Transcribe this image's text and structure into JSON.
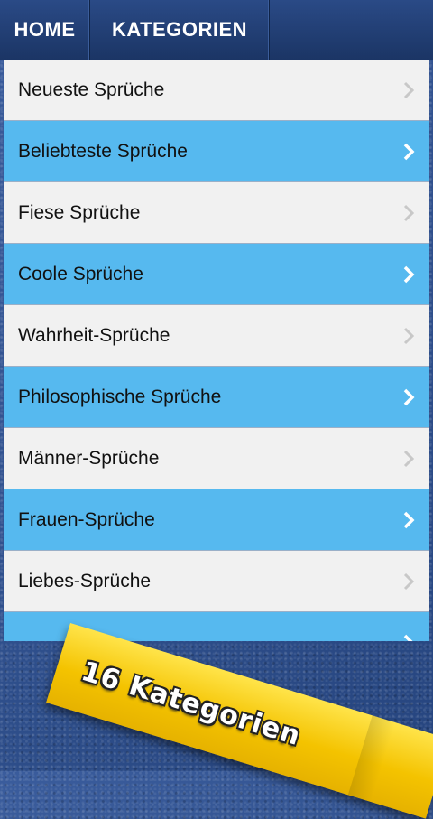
{
  "nav": {
    "home": "HOME",
    "categories": "KATEGORIEN"
  },
  "list": {
    "items": [
      {
        "label": "Neueste Sprüche",
        "style": "light"
      },
      {
        "label": "Beliebteste Sprüche",
        "style": "blue"
      },
      {
        "label": "Fiese Sprüche",
        "style": "light"
      },
      {
        "label": "Coole Sprüche",
        "style": "blue"
      },
      {
        "label": "Wahrheit-Sprüche",
        "style": "light"
      },
      {
        "label": "Philosophische Sprüche",
        "style": "blue"
      },
      {
        "label": "Männer-Sprüche",
        "style": "light"
      },
      {
        "label": "Frauen-Sprüche",
        "style": "blue"
      },
      {
        "label": "Liebes-Sprüche",
        "style": "light"
      },
      {
        "label": "",
        "style": "blue"
      }
    ]
  },
  "banner": {
    "text": "16 Kategorien"
  },
  "colors": {
    "accent_blue": "#56b9ef",
    "row_light": "#f1f1f1",
    "nav_bg": "#1b3565",
    "banner_yellow": "#f4c300"
  },
  "icons": {
    "row_chevron": "chevron-right-icon"
  }
}
